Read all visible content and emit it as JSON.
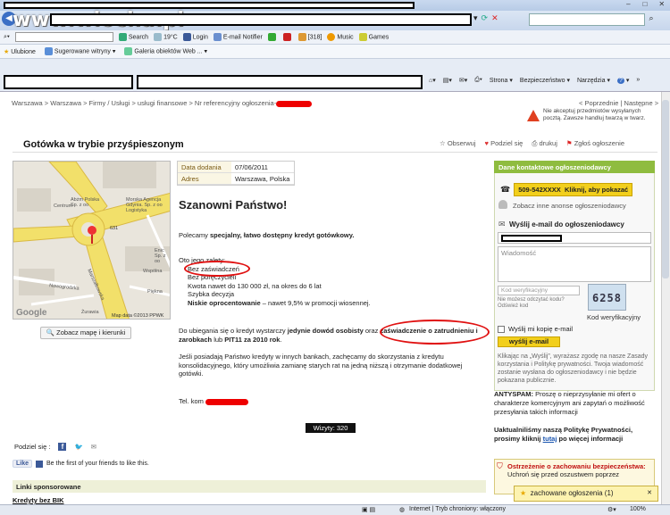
{
  "browser": {
    "logo": "www.wiocha.pl",
    "search_label": "Search",
    "weather": "19°C",
    "login": "Login",
    "email_notifier": "E-mail Notifier",
    "mail_count": "[318]",
    "music": "Music",
    "games": "Games",
    "favorites": "Ulubione",
    "suggested_sites": "Sugerowane witryny",
    "web_gallery": "Galeria obiektów Web ...",
    "cmd_page": "Strona",
    "cmd_security": "Bezpieczeństwo",
    "cmd_tools": "Narzędzia",
    "cmd_help": "?"
  },
  "page": {
    "breadcrumb": "Warszawa > Warszawa > Firmy / Usługi > usługi finansowe > Nr referencyjny ogłoszenia-",
    "prev_next": "< Poprzednie | Następne >",
    "warning_note": "Nie akceptuj przedmiotów wysyłanych pocztą. Zawsze handluj twarzą w twarz.",
    "title": "Gotówka w trybie przyśpieszonym",
    "actions": {
      "watch": "Obserwuj",
      "share": "Podziel się",
      "print": "drukuj",
      "report": "Zgłoś ogłoszenie"
    },
    "map": {
      "link": "Zobacz mapę i kierunki",
      "labels": [
        "Abżm Polska Sp. z oo",
        "Morska Agencja Gdynia. Sp. z oo Logistyka",
        "Centrum",
        "Enic Sp. z oo",
        "Marszałkowska",
        "Nowogrodzka",
        "Piękna",
        "Wspólna",
        "Żurawia",
        "631"
      ],
      "credit": "Map data ©2013 PPWK",
      "brand": "Google"
    },
    "info": {
      "date_label": "Data dodania",
      "date_value": "07/06/2011",
      "address_label": "Adres",
      "address_value": "Warszawa, Polska"
    },
    "greeting": "Szanowni Państwo!",
    "intro_prefix": "Polecamy ",
    "intro_bold": "specjalny, łatwo dostępny kredyt gotówkowy.",
    "advantages_title": "Oto jego zalety:",
    "advantages": [
      "Bez zaświadczeń",
      "Bez poręczycieli",
      "Kwota nawet do 130 000 zł, na okres do 6 lat",
      "Szybka decyzja"
    ],
    "rate_bold": "Niskie oprocentowanie",
    "rate_rest": " – nawet 9,5% w promocji wiosennej.",
    "p3_a": "Do ubiegania się o kredyt wystarczy ",
    "p3_b": "jedynie dowód osobisty",
    "p3_c": " oraz ",
    "p3_d": "zaświadczenie o zatrudnieniu i zarobkach",
    "p3_e": " lub ",
    "p3_f": "PIT11 za 2010 rok",
    "p3_g": ".",
    "p4": "Jeśli posiadają Państwo kredyty w innych bankach, zachęcamy do skorzystania z kredytu konsolidacyjnego, który umożliwia zamianę starych rat na jedną niższą i otrzymanie dodatkowej gotówki.",
    "tel_label": "Tel. kom",
    "visits": "Wizyty: 320",
    "share_label": "Podziel się :",
    "fb_like": "Like",
    "fb_text": "Be the first of your friends to like this.",
    "sponsored": "Linki sponsorowane",
    "sponsored_first": "Kredyty bez BIK"
  },
  "contact": {
    "header": "Dane kontaktowe ogłoszeniodawcy",
    "phone": "509-542XXXX",
    "phone_cta": "Kliknij, aby pokazać",
    "other_ads": "Zobacz inne anonse ogłoszeniodawcy",
    "mail_title": "Wyślij e-mail do ogłoszeniodawcy",
    "message_placeholder": "Wiadomość",
    "code_placeholder": "Kod weryfikacyjny",
    "code_hint": "Nie możesz odczytać kodu? Odśwież kod",
    "captcha": "6258",
    "captcha_label": "Kod weryfikacyjny",
    "copy_me": "Wyślij mi kopię e-mail",
    "send": "wyślij e-mail",
    "policy": "Klikając na „Wyślij”, wyrażasz zgodę na nasze Zasady korzystania i Politykę prywatności. Twoja wiadomość zostanie wysłana do ogłoszeniodawcy i nie będzie pokazana publicznie.",
    "antispam_bold": "ANTYSPAM:",
    "antispam": " Proszę o nieprzysyłanie mi ofert o charakterze komercyjnym ani zapytań o możliwość przesyłania takich informacji",
    "privacy_a": "Uaktualniliśmy naszą Politykę Prywatności, prosimy kliknij ",
    "privacy_link": "tutaj",
    "privacy_b": " po więcej informacji",
    "warn_title": "Ostrzeżenie o zachowaniu bezpieczeństwa:",
    "warn_text": "Uchroń się przed oszustwem poprzez",
    "saved_ads": "zachowane ogłoszenia (1)"
  },
  "status": {
    "zone": "Internet | Tryb chroniony: włączony",
    "zoom": "100%"
  }
}
